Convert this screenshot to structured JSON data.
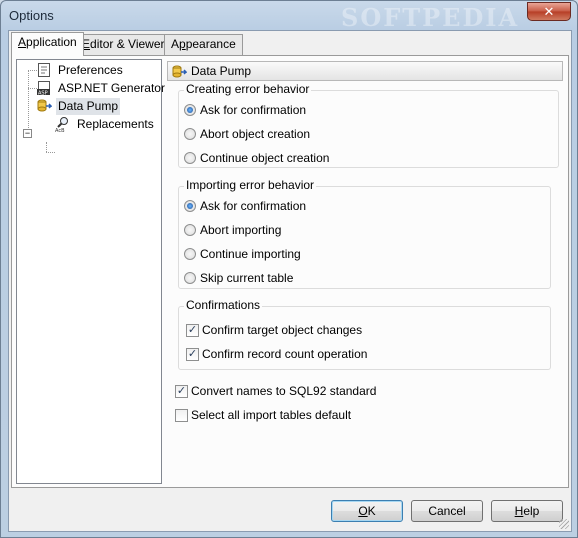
{
  "window": {
    "title": "Options",
    "watermark": "SOFTPEDIA",
    "close_glyph": "✕"
  },
  "tabs": [
    {
      "pre": "",
      "key": "A",
      "post": "pplication",
      "active": true
    },
    {
      "pre": "",
      "key": "E",
      "post": "ditor & Viewers",
      "active": false
    },
    {
      "pre": "A",
      "key": "p",
      "post": "pearance",
      "active": false
    }
  ],
  "tree": {
    "items": [
      {
        "label": "Preferences",
        "icon": "preferences-doc-icon"
      },
      {
        "label": "ASP.NET Generator",
        "icon": "asp-icon"
      },
      {
        "label": "Data Pump",
        "icon": "data-pump-icon",
        "selected": true,
        "expander": "−"
      },
      {
        "label": "Replacements",
        "icon": "replacements-icon"
      }
    ]
  },
  "page": {
    "header": "Data Pump",
    "creating_error": {
      "title": "Creating error behavior",
      "options": [
        "Ask for confirmation",
        "Abort object creation",
        "Continue object creation"
      ],
      "selected": 0
    },
    "importing_error": {
      "title": "Importing error behavior",
      "options": [
        "Ask for confirmation",
        "Abort importing",
        "Continue importing",
        "Skip current table"
      ],
      "selected": 0
    },
    "confirmations": {
      "title": "Confirmations",
      "checks": [
        {
          "label": "Confirm target object changes",
          "checked": true
        },
        {
          "label": "Confirm record count operation",
          "checked": true
        }
      ]
    },
    "extra_checks": [
      {
        "label": "Convert names to SQL92 standard",
        "checked": true
      },
      {
        "label": "Select all import tables default",
        "checked": false
      }
    ]
  },
  "buttons": {
    "ok": {
      "key": "O",
      "post": "K"
    },
    "cancel": {
      "label": "Cancel"
    },
    "help": {
      "key": "H",
      "post": "elp"
    }
  },
  "check_glyph": "✓"
}
